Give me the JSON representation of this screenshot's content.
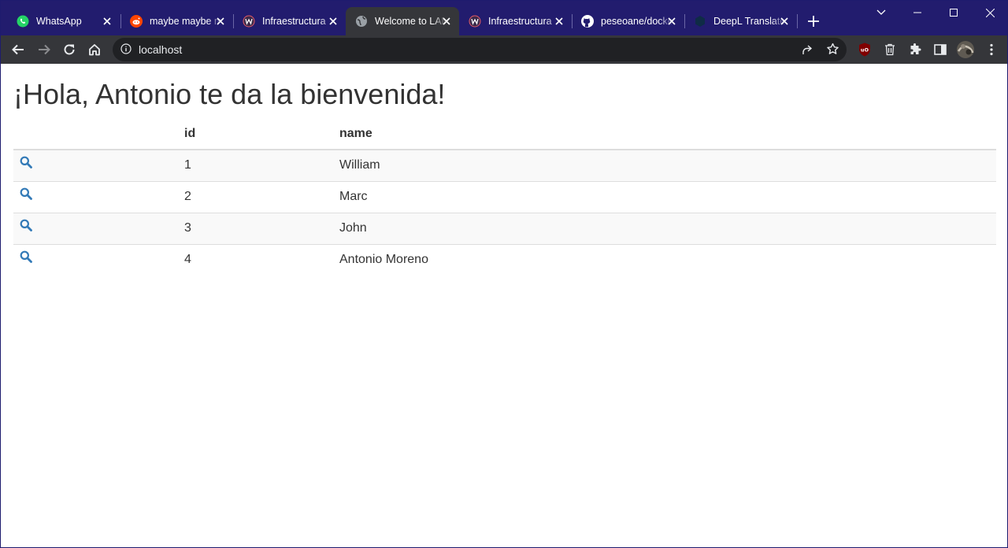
{
  "browser": {
    "tabs": [
      {
        "title": "WhatsApp",
        "icon": "whatsapp-icon",
        "active": false
      },
      {
        "title": "maybe maybe maybe",
        "icon": "reddit-icon",
        "active": false
      },
      {
        "title": "Infraestructura",
        "icon": "w-logo-icon",
        "active": false
      },
      {
        "title": "Welcome to LAMP",
        "icon": "globe-icon",
        "active": true
      },
      {
        "title": "Infraestructura",
        "icon": "w-logo-icon",
        "active": false
      },
      {
        "title": "peseoane/docker",
        "icon": "github-icon",
        "active": false
      },
      {
        "title": "DeepL Translate",
        "icon": "deepl-icon",
        "active": false
      }
    ],
    "url": "localhost"
  },
  "page": {
    "heading": "¡Hola, Antonio te da la bienvenida!",
    "table": {
      "headers": [
        "",
        "id",
        "name"
      ],
      "rows": [
        {
          "id": "1",
          "name": "William"
        },
        {
          "id": "2",
          "name": "Marc"
        },
        {
          "id": "3",
          "name": "John"
        },
        {
          "id": "4",
          "name": "Antonio Moreno"
        }
      ]
    }
  },
  "colors": {
    "tabstrip": "#221c6e",
    "toolbar": "#35363a",
    "omnibox": "#202124",
    "link_icon": "#337ab7",
    "text": "#333333"
  }
}
